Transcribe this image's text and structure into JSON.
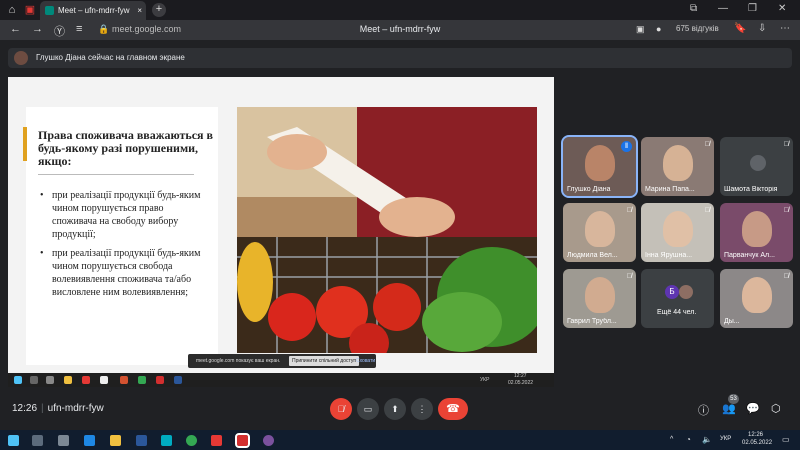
{
  "browser": {
    "tab_title": "Meet – ufn-mdrr-fyw",
    "tab_close": "×",
    "new_tab": "+",
    "address": "meet.google.com",
    "page_title": "Meet – ufn-mdrr-fyw",
    "reviews": "675 відгуків"
  },
  "presenter_banner": "Глушко Діана сейчас на главном экране",
  "slide": {
    "title": "Права споживача вважаються в будь-якому разі порушеними, якщо:",
    "bullets": [
      "при реалізації продукції будь-яким чином порушується право споживача на свободу вибору продукції;",
      "при реалізації продукції будь-яким чином порушується свобода волевиявлення споживача та/або висловлене ним волевиявлення;"
    ]
  },
  "share_notice": {
    "message": "meet.google.com показує ваш екран.",
    "stop_label": "Припинити спільний доступ",
    "hide_label": "Сховати"
  },
  "inner_taskbar": {
    "lang": "УКР",
    "time": "12:27",
    "date": "02.05.2022"
  },
  "participants": [
    {
      "name": "Глушко Діана",
      "speaking": true
    },
    {
      "name": "Марина Папа...",
      "speaking": false
    },
    {
      "name": "Шамота Вікторія",
      "speaking": false
    },
    {
      "name": "Людмила Вел...",
      "speaking": false
    },
    {
      "name": "Інна Ярушна...",
      "speaking": false
    },
    {
      "name": "Парванчук Ал...",
      "speaking": false
    },
    {
      "name": "Гаврил Трубл...",
      "speaking": false
    },
    {
      "name": "Ещё 44 чел.",
      "speaking": false,
      "initial": "Б"
    },
    {
      "name": "Ды...",
      "speaking": false
    }
  ],
  "meeting": {
    "time": "12:26",
    "code": "ufn-mdrr-fyw",
    "participants_count": "53"
  },
  "taskbar": {
    "lang": "УКР",
    "time": "12:26",
    "date": "02.05.2022"
  },
  "colors": {
    "meet_bg": "#202124",
    "hangup_red": "#ea4335",
    "accent_blue": "#8ab4f8",
    "slide_accent": "#e0a11f"
  }
}
